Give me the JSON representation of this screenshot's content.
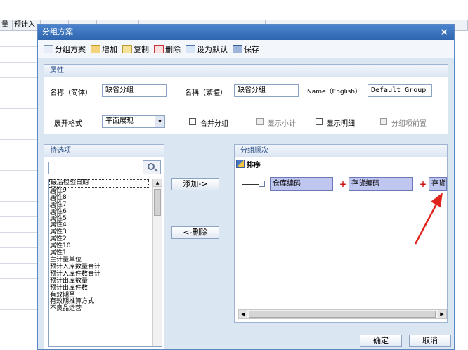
{
  "background": {
    "headers": [
      "量",
      "预计入",
      "",
      "",
      "",
      "",
      "",
      ""
    ]
  },
  "dialog": {
    "title": "分组方案",
    "close_glyph": "×",
    "toolbar": {
      "scheme_label": "分组方案",
      "add_label": "增加",
      "copy_label": "复制",
      "delete_label": "删除",
      "default_label": "设为默认",
      "save_label": "保存"
    },
    "properties": {
      "header": "属性",
      "name_simplified_label": "名称（简体）",
      "name_simplified_value": "缺省分组",
      "name_traditional_label": "名稱（繁體）",
      "name_traditional_value": "缺省分組",
      "name_english_label": "Name（English）",
      "name_english_value": "Default Group",
      "expand_mode_label": "展开格式",
      "expand_mode_value": "平面展现",
      "merge_group_label": "合并分组",
      "show_subtotal_label": "显示小计",
      "show_detail_label": "显示明细",
      "group_front_label": "分组项前置"
    },
    "candidates": {
      "header": "待选项",
      "search_value": "",
      "items": [
        "最后检验日期",
        "属性9",
        "属性8",
        "属性7",
        "属性6",
        "属性5",
        "属性4",
        "属性3",
        "属性2",
        "属性10",
        "属性1",
        "主计量单位",
        "预计入库数量合计",
        "预计入库件数合计",
        "预计出库数量",
        "预计出库件数",
        "有效期至",
        "有效期推算方式",
        "不良品运营"
      ]
    },
    "add_button": "添加->",
    "remove_button": "<-删除",
    "grouping": {
      "header": "分组顺次",
      "sort_label": "排序",
      "chips": [
        "仓库编码",
        "存货编码",
        "存货"
      ],
      "plus": "+",
      "collapse_glyph": "-"
    },
    "ok_button": "确定",
    "cancel_button": "取消"
  }
}
